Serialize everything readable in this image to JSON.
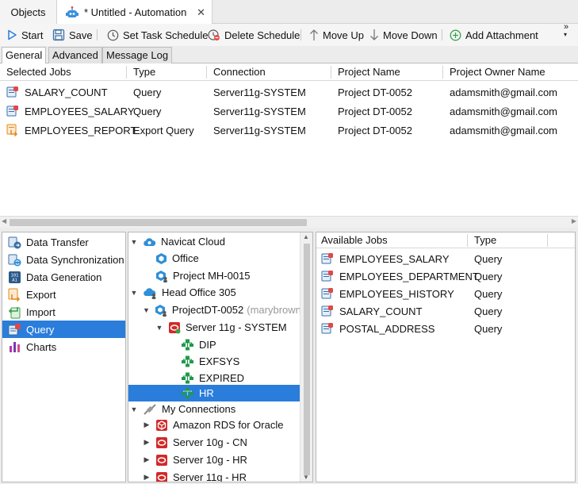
{
  "window_tabs": {
    "objects_label": "Objects",
    "automation_label": "* Untitled - Automation",
    "close_glyph": "✕"
  },
  "toolbar": {
    "start": "Start",
    "save": "Save",
    "set_task_schedule": "Set Task Schedule",
    "delete_schedule": "Delete Schedule",
    "move_up": "Move Up",
    "move_down": "Move Down",
    "add_attachment": "Add Attachment",
    "overflow_glyph": "»"
  },
  "sub_tabs": [
    "General",
    "Advanced",
    "Message Log"
  ],
  "jobs_table": {
    "columns": [
      "Selected Jobs",
      "Type",
      "Connection",
      "Project Name",
      "Project Owner Name"
    ],
    "rows": [
      {
        "job": "SALARY_COUNT",
        "type": "Query",
        "connection": "Server11g-SYSTEM",
        "project": "Project DT-0052",
        "owner": "adamsmith@gmail.com",
        "icon": "query-icon"
      },
      {
        "job": "EMPLOYEES_SALARY",
        "type": "Query",
        "connection": "Server11g-SYSTEM",
        "project": "Project DT-0052",
        "owner": "adamsmith@gmail.com",
        "icon": "query-icon"
      },
      {
        "job": "EMPLOYEES_REPORT",
        "type": "Export Query",
        "connection": "Server11g-SYSTEM",
        "project": "Project DT-0052",
        "owner": "adamsmith@gmail.com",
        "icon": "export-query-icon"
      }
    ]
  },
  "categories": [
    {
      "label": "Data Transfer",
      "icon": "data-transfer-icon"
    },
    {
      "label": "Data Synchronization",
      "icon": "data-sync-icon"
    },
    {
      "label": "Data Generation",
      "icon": "data-generation-icon"
    },
    {
      "label": "Export",
      "icon": "export-icon"
    },
    {
      "label": "Import",
      "icon": "import-icon"
    },
    {
      "label": "Query",
      "icon": "query-icon",
      "selected": true
    },
    {
      "label": "Charts",
      "icon": "charts-icon"
    }
  ],
  "tree": [
    {
      "label": "Navicat Cloud",
      "icon": "cloud-icon"
    },
    {
      "label": "Office",
      "icon": "project-icon"
    },
    {
      "label": "Project MH-0015",
      "icon": "project-user-icon"
    },
    {
      "label": "Head Office 305",
      "icon": "cloud-group-icon"
    },
    {
      "label": "ProjectDT-0052",
      "suffix": "(marybrown)",
      "icon": "project-user-icon"
    },
    {
      "label": "Server 11g - SYSTEM",
      "icon": "oracle-server-icon"
    },
    {
      "label": "DIP",
      "icon": "schema-icon"
    },
    {
      "label": "EXFSYS",
      "icon": "schema-icon"
    },
    {
      "label": "EXPIRED",
      "icon": "schema-icon"
    },
    {
      "label": "HR",
      "icon": "schema-icon",
      "selected": true
    },
    {
      "label": "My Connections",
      "icon": "connections-icon"
    },
    {
      "label": "Amazon RDS for Oracle",
      "icon": "amazon-rds-icon"
    },
    {
      "label": "Server 10g - CN",
      "icon": "oracle-server-icon"
    },
    {
      "label": "Server 10g - HR",
      "icon": "oracle-server-icon"
    },
    {
      "label": "Server 11g - HR",
      "icon": "oracle-server-icon"
    }
  ],
  "available_jobs": {
    "columns": [
      "Available Jobs",
      "Type"
    ],
    "rows": [
      {
        "job": "EMPLOYEES_SALARY",
        "type": "Query"
      },
      {
        "job": "EMPLOYEES_DEPARTMENT",
        "type": "Query"
      },
      {
        "job": "EMPLOYEES_HISTORY",
        "type": "Query"
      },
      {
        "job": "SALARY_COUNT",
        "type": "Query"
      },
      {
        "job": "POSTAL_ADDRESS",
        "type": "Query"
      }
    ]
  },
  "colors": {
    "selection": "#2a7ddb",
    "oracle_red": "#d12a2a",
    "schema_green": "#1f9a4a",
    "cloud_blue": "#2f8fd8"
  }
}
